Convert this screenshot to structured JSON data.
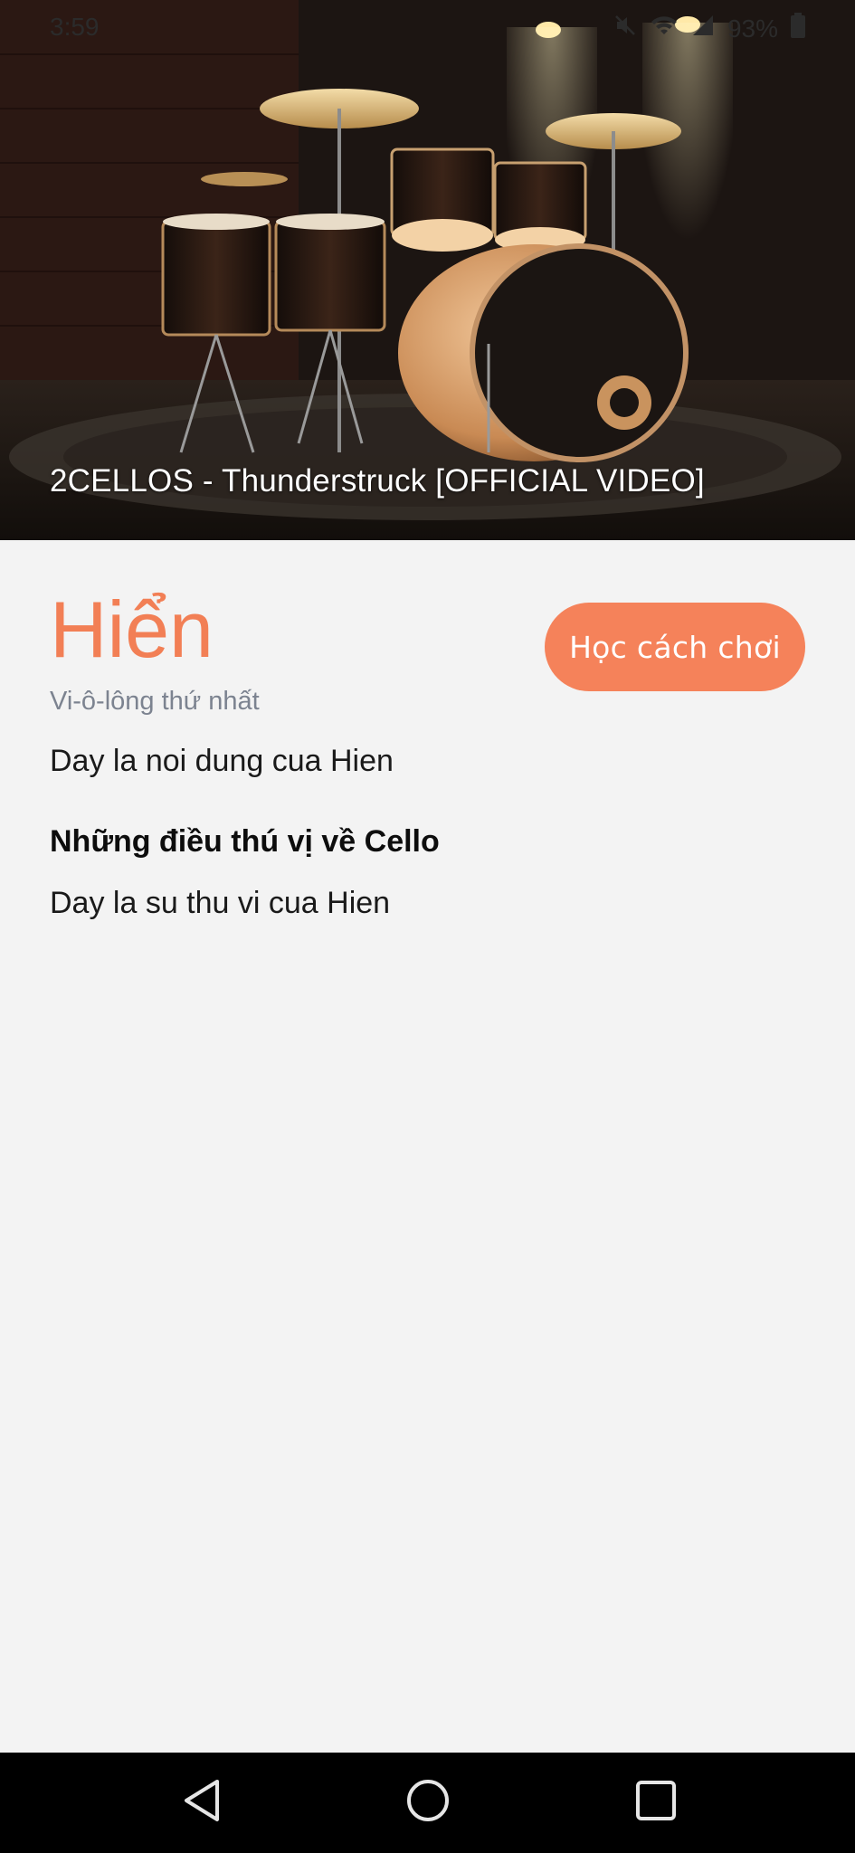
{
  "status_bar": {
    "time": "3:59",
    "battery_percent": "93%",
    "icons": [
      "navigation-icon",
      "notification-off-icon",
      "mute-icon",
      "wifi-icon",
      "signal-icon",
      "battery-icon"
    ]
  },
  "video": {
    "title": "2CELLOS - Thunderstruck [OFFICIAL VIDEO]",
    "thumbnail": "drum-kit-thumbnail"
  },
  "artist": {
    "name": "Hiển",
    "role": "Vi-ô-lông thứ nhất",
    "content": "Day la noi dung cua Hien"
  },
  "learn_button": {
    "label": "Học cách chơi"
  },
  "fun_facts": {
    "heading": "Những điều thú vị về Cello",
    "text": "Day la su thu vi cua Hien"
  },
  "nav_bar": {
    "icons": [
      "back-icon",
      "home-icon",
      "recents-icon"
    ]
  },
  "colors": {
    "accent": "#f27f55",
    "button": "#f5825a",
    "background": "#f3f3f3",
    "subtitle": "#7c8390"
  }
}
